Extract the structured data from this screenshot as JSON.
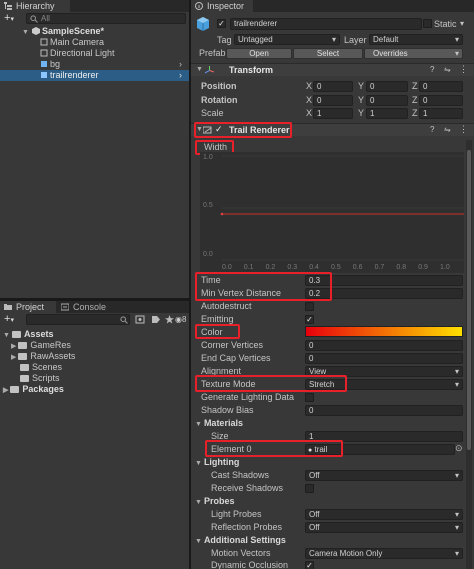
{
  "hierarchy": {
    "tab": "Hierarchy",
    "search_placeholder": "All",
    "scene": "SampleScene*",
    "items": [
      "Main Camera",
      "Directional Light",
      "bg",
      "trailrenderer"
    ]
  },
  "project": {
    "tabs": [
      "Project",
      "Console"
    ],
    "badge": "8",
    "tree": [
      "Assets",
      "GameRes",
      "RawAssets",
      "Scenes",
      "Scripts",
      "Packages"
    ]
  },
  "inspector": {
    "tab": "Inspector",
    "object_name": "trailrenderer",
    "static_label": "Static",
    "tag_label": "Tag",
    "tag_value": "Untagged",
    "layer_label": "Layer",
    "layer_value": "Default",
    "prefab_label": "Prefab",
    "prefab_open": "Open",
    "prefab_select": "Select",
    "prefab_overrides": "Overrides",
    "transform": {
      "title": "Transform",
      "position_label": "Position",
      "rotation_label": "Rotation",
      "scale_label": "Scale",
      "axis_x": "X",
      "axis_y": "Y",
      "axis_z": "Z",
      "position": [
        "0",
        "0",
        "0"
      ],
      "rotation": [
        "0",
        "0",
        "0"
      ],
      "scale": [
        "1",
        "1",
        "1"
      ]
    },
    "trail": {
      "title": "Trail Renderer",
      "width_label": "Width",
      "curve_y_labels": [
        "1.0",
        "0.5",
        "0.0"
      ],
      "curve_x_labels": [
        "0.0",
        "0.1",
        "0.2",
        "0.3",
        "0.4",
        "0.5",
        "0.6",
        "0.7",
        "0.8",
        "0.9",
        "1.0"
      ],
      "curve_value": 0.5,
      "time_label": "Time",
      "time_value": "0.3",
      "min_vertex_label": "Min Vertex Distance",
      "min_vertex_value": "0.2",
      "autodestruct_label": "Autodestruct",
      "emitting_label": "Emitting",
      "color_label": "Color",
      "color_start": "#e8000c",
      "color_end": "#ffe000",
      "corner_label": "Corner Vertices",
      "corner_value": "0",
      "endcap_label": "End Cap Vertices",
      "endcap_value": "0",
      "alignment_label": "Alignment",
      "alignment_value": "View",
      "texture_mode_label": "Texture Mode",
      "texture_mode_value": "Stretch",
      "gen_lighting_label": "Generate Lighting Data",
      "shadow_bias_label": "Shadow Bias",
      "shadow_bias_value": "0",
      "materials_label": "Materials",
      "size_label": "Size",
      "size_value": "1",
      "element0_label": "Element 0",
      "element0_value": "trail",
      "lighting_label": "Lighting",
      "cast_shadows_label": "Cast Shadows",
      "cast_shadows_value": "Off",
      "receive_shadows_label": "Receive Shadows",
      "probes_label": "Probes",
      "light_probes_label": "Light Probes",
      "light_probes_value": "Off",
      "reflection_probes_label": "Reflection Probes",
      "reflection_probes_value": "Off",
      "additional_label": "Additional Settings",
      "motion_vectors_label": "Motion Vectors",
      "motion_vectors_value": "Camera Motion Only",
      "dynamic_occlusion_label": "Dynamic Occlusion"
    }
  },
  "colors": {
    "highlight": "#e8202a",
    "selection": "#2c5d87"
  }
}
